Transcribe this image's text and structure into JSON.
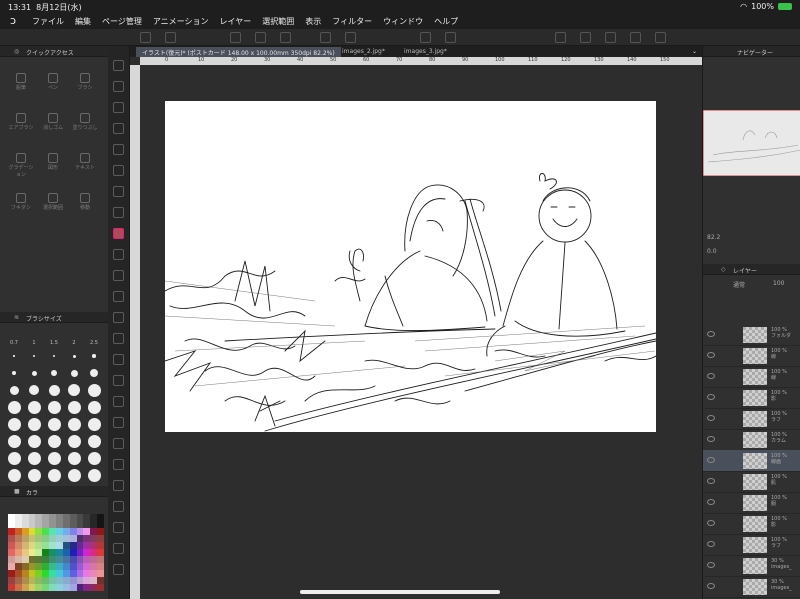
{
  "status": {
    "time": "13:31",
    "date": "8月12日(水)",
    "battery": "100%"
  },
  "menu": [
    "ファイル",
    "編集",
    "ページ管理",
    "アニメーション",
    "レイヤー",
    "選択範囲",
    "表示",
    "フィルター",
    "ウィンドウ",
    "ヘルプ"
  ],
  "panels": {
    "quick_access": "クイックアクセス",
    "brush_size": "ブラシサイズ",
    "color_set": "カラ",
    "navigator": "ナビゲーター",
    "layer": "レイヤー"
  },
  "quick_access_items": [
    "鉛筆",
    "ペン",
    "ブラシ",
    "エアブラシ",
    "消しゴム",
    "塗りつぶし",
    "グラデーション",
    "図形",
    "テキスト",
    "フキダシ",
    "選択範囲",
    "移動"
  ],
  "brush_sizes": [
    "0.7",
    "1",
    "1.5",
    "2",
    "2.5"
  ],
  "tabs": {
    "active": "イラスト(復元)* (ポストカード 148.00 x 100.00mm 350dpi 82.2%)",
    "t2": "images_2.jpg*",
    "t3": "images_3.jpg*"
  },
  "ruler_marks": [
    "0",
    "10",
    "20",
    "30",
    "40",
    "50",
    "60",
    "70",
    "80",
    "90",
    "100",
    "110",
    "120",
    "130",
    "140",
    "150"
  ],
  "navigator": {
    "zoom": "82.2",
    "rotation": "0.0"
  },
  "layer_panel": {
    "blend": "通常",
    "opacity": "100"
  },
  "layers": [
    {
      "pct": "100 %",
      "name": "フォルダ"
    },
    {
      "pct": "100 %",
      "name": "線"
    },
    {
      "pct": "100 %",
      "name": "線"
    },
    {
      "pct": "100 %",
      "name": "影"
    },
    {
      "pct": "100 %",
      "name": "ラフ"
    },
    {
      "pct": "100 %",
      "name": "カラム"
    },
    {
      "pct": "100 %",
      "name": "線画"
    },
    {
      "pct": "100 %",
      "name": "肌"
    },
    {
      "pct": "100 %",
      "name": "服"
    },
    {
      "pct": "100 %",
      "name": "影"
    },
    {
      "pct": "100 %",
      "name": "ラフ"
    },
    {
      "pct": "30 %",
      "name": "images_"
    },
    {
      "pct": "30 %",
      "name": "images_"
    }
  ]
}
